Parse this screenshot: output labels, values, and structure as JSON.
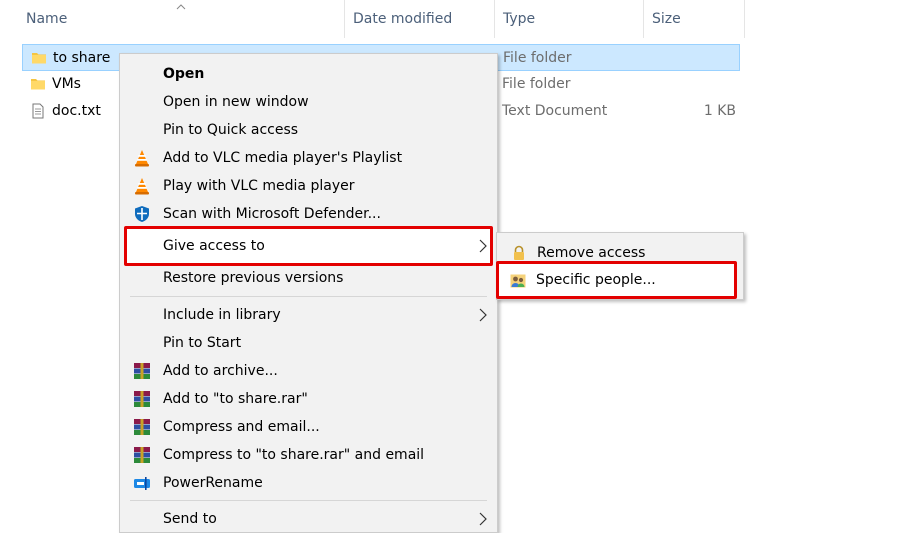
{
  "columns": {
    "name": "Name",
    "date_modified": "Date modified",
    "type": "Type",
    "size": "Size"
  },
  "files": [
    {
      "name": "to share",
      "type": "File folder",
      "size": "",
      "icon": "folder-icon",
      "selected": true
    },
    {
      "name": "VMs",
      "type": "File folder",
      "size": "",
      "icon": "folder-icon",
      "selected": false
    },
    {
      "name": "doc.txt",
      "type": "Text Document",
      "size": "1 KB",
      "icon": "text-file-icon",
      "selected": false
    }
  ],
  "context_menu": {
    "items": [
      {
        "label": "Open",
        "bold": true,
        "icon": ""
      },
      {
        "label": "Open in new window",
        "icon": ""
      },
      {
        "label": "Pin to Quick access",
        "icon": ""
      },
      {
        "label": "Add to VLC media player's Playlist",
        "icon": "vlc-icon"
      },
      {
        "label": "Play with VLC media player",
        "icon": "vlc-icon"
      },
      {
        "label": "Scan with Microsoft Defender...",
        "icon": "defender-shield-icon"
      },
      {
        "label": "Give access to",
        "icon": "",
        "submenu": true,
        "highlighted": true
      },
      {
        "label": "Restore previous versions",
        "icon": ""
      },
      {
        "label": "Include in library",
        "icon": "",
        "submenu": true
      },
      {
        "label": "Pin to Start",
        "icon": ""
      },
      {
        "label": "Add to archive...",
        "icon": "winrar-icon"
      },
      {
        "label": "Add to \"to share.rar\"",
        "icon": "winrar-icon"
      },
      {
        "label": "Compress and email...",
        "icon": "winrar-icon"
      },
      {
        "label": "Compress to \"to share.rar\" and email",
        "icon": "winrar-icon"
      },
      {
        "label": "PowerRename",
        "icon": "powerrename-icon"
      },
      {
        "label": "Send to",
        "icon": "",
        "submenu": true
      }
    ]
  },
  "submenu": {
    "items": [
      {
        "label": "Remove access",
        "icon": "lock-icon"
      },
      {
        "label": "Specific people...",
        "icon": "people-icon",
        "highlighted": true
      }
    ]
  },
  "colors": {
    "selection_bg": "#cce8ff",
    "highlight_border": "#e30000",
    "menu_bg": "#f2f2f2"
  }
}
